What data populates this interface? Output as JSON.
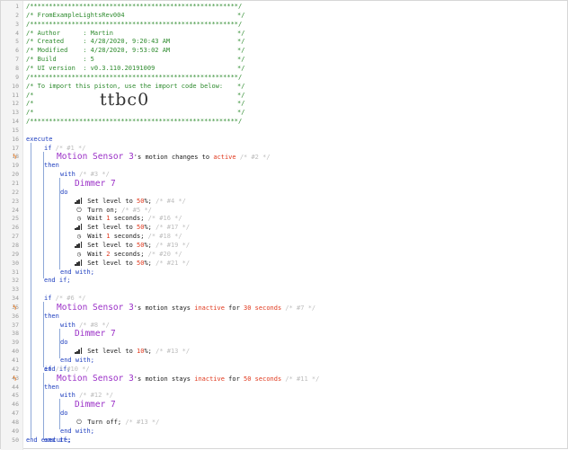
{
  "header": {
    "border": "/*******************************************************/",
    "lines": [
      {
        "text": "/* FromExampleLightsRev004",
        "end": "*/"
      },
      {
        "text": "/* Author      : Martin",
        "end": "*/"
      },
      {
        "text": "/* Created     : 4/28/2020, 9:20:43 AM",
        "end": "*/"
      },
      {
        "text": "/* Modified    : 4/28/2020, 9:53:02 AM",
        "end": "*/"
      },
      {
        "text": "/* Build       : 5",
        "end": "*/"
      },
      {
        "text": "/* UI version  : v0.3.110.20191009",
        "end": "*/"
      },
      {
        "text": "/* To import this piston, use the import code below:",
        "end": "*/"
      },
      {
        "text": "/*",
        "end": "*/"
      }
    ],
    "import_code": "ttbc0"
  },
  "code": {
    "execute": "execute",
    "end_execute": "end execute;",
    "if": "if",
    "then": "then",
    "with": "with",
    "do": "do",
    "end_with": "end with;",
    "end_if": "end if;",
    "blocks": [
      {
        "if_comment": "/* #1 */",
        "device": "Motion Sensor 3",
        "cond_pre": "'s motion changes to ",
        "cond_value": "active",
        "cond_post": "",
        "cond_comment": "/* #2 */",
        "with_comment": "/* #3 */",
        "target": "Dimmer 7",
        "actions": [
          {
            "icon": "signal-icon",
            "pre": "Set level to ",
            "val": "50",
            "post": "%;",
            "comment": "/* #4 */"
          },
          {
            "icon": "power-icon",
            "pre": "Turn on;",
            "val": "",
            "post": "",
            "comment": "/* #5 */"
          },
          {
            "icon": "clock-icon",
            "pre": "Wait ",
            "val": "1",
            "post": " seconds;",
            "comment": "/* #16 */"
          },
          {
            "icon": "signal-icon",
            "pre": "Set level to ",
            "val": "50",
            "post": "%;",
            "comment": "/* #17 */"
          },
          {
            "icon": "clock-icon",
            "pre": "Wait ",
            "val": "1",
            "post": " seconds;",
            "comment": "/* #18 */"
          },
          {
            "icon": "signal-icon",
            "pre": "Set level to ",
            "val": "50",
            "post": "%;",
            "comment": "/* #19 */"
          },
          {
            "icon": "clock-icon",
            "pre": "Wait ",
            "val": "2",
            "post": " seconds;",
            "comment": "/* #20 */"
          },
          {
            "icon": "signal-icon",
            "pre": "Set level to ",
            "val": "50",
            "post": "%;",
            "comment": "/* #21 */"
          }
        ]
      },
      {
        "if_comment": "/* #6 */",
        "device": "Motion Sensor 3",
        "cond_pre": "'s motion stays ",
        "cond_value": "inactive",
        "cond_post": " for 30 seconds",
        "cond_comment": "/* #7 */",
        "with_comment": "/* #8 */",
        "target": "Dimmer 7",
        "actions": [
          {
            "icon": "signal-icon",
            "pre": "Set level to ",
            "val": "10",
            "post": "%;",
            "comment": "/* #13 */"
          }
        ]
      },
      {
        "if_comment": "/* #10 */",
        "device": "Motion Sensor 3",
        "cond_pre": "'s motion stays ",
        "cond_value": "inactive",
        "cond_post": " for 50 seconds",
        "cond_comment": "/* #11 */",
        "with_comment": "/* #12 */",
        "target": "Dimmer 7",
        "actions": [
          {
            "icon": "power-icon",
            "pre": "Turn off;",
            "val": "",
            "post": "",
            "comment": "/* #13 */"
          }
        ]
      }
    ]
  },
  "line_count": 50,
  "colors": {
    "comment": "#2e8b2e",
    "keyword": "#1f3fbf",
    "device": "#9b30c7",
    "value": "#e0391e",
    "trigger": "#e8761a"
  }
}
